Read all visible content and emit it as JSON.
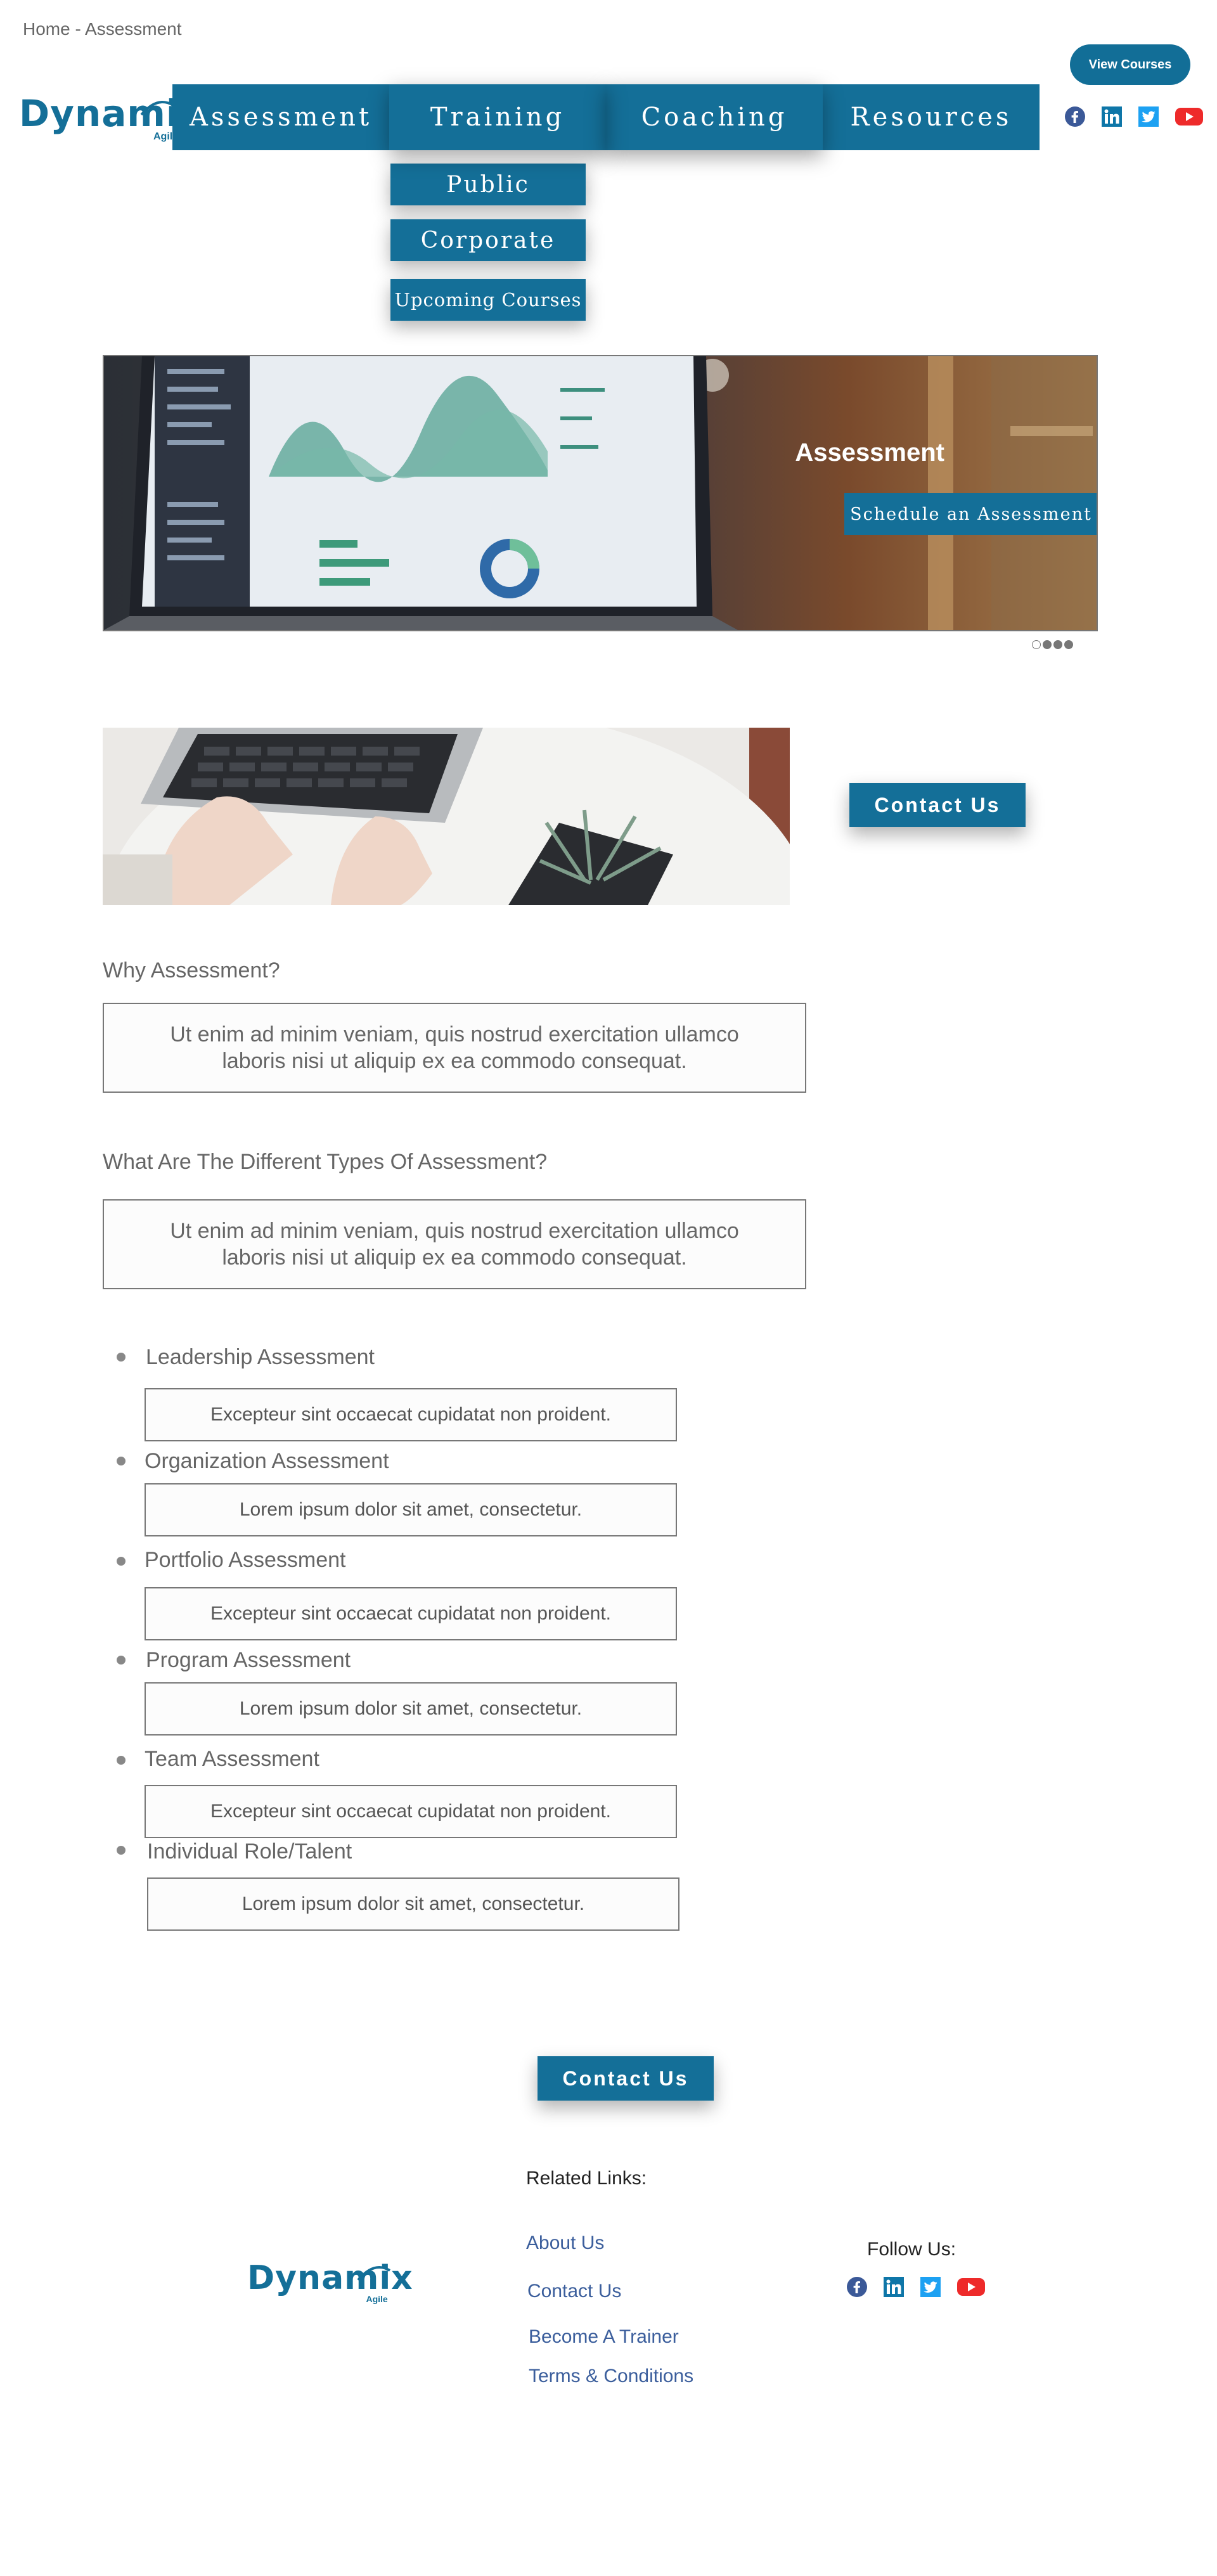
{
  "breadcrumb": "Home - Assessment",
  "header": {
    "view_courses": "View Courses",
    "logo_word": "Dynamix",
    "logo_sub": "Agile"
  },
  "nav": {
    "items": [
      "Assessment",
      "Training",
      "Coaching",
      "Resources"
    ],
    "training_submenu": [
      "Public",
      "Corporate",
      "Upcoming Courses"
    ]
  },
  "social_icons": [
    "facebook-icon",
    "linkedin-icon",
    "twitter-icon",
    "youtube-icon"
  ],
  "colors": {
    "brand": "#146f98",
    "facebook": "#3b5998",
    "linkedin": "#0e76a8",
    "twitter": "#1da1f2",
    "youtube": "#ee2a2a"
  },
  "banner": {
    "title": "Assessment",
    "button": "Schedule an Assessment",
    "slides": 4,
    "active_slide": 1
  },
  "contact_us_label": "Contact Us",
  "sections": [
    {
      "heading": "Why Assessment?",
      "text": "Ut enim ad minim veniam, quis nostrud exercitation ullamco laboris nisi ut aliquip ex ea commodo consequat."
    },
    {
      "heading": "What Are The Different Types Of Assessment?",
      "text": "Ut enim ad minim veniam, quis nostrud exercitation ullamco laboris nisi ut aliquip ex ea commodo consequat."
    }
  ],
  "assessments": [
    {
      "label": "Leadership Assessment",
      "desc": "Excepteur sint occaecat cupidatat non proident."
    },
    {
      "label": "Organization Assessment",
      "desc": "Lorem ipsum dolor sit amet, consectetur."
    },
    {
      "label": "Portfolio Assessment",
      "desc": "Excepteur sint occaecat cupidatat non proident."
    },
    {
      "label": "Program Assessment",
      "desc": "Lorem ipsum dolor sit amet, consectetur."
    },
    {
      "label": "Team Assessment",
      "desc": "Excepteur sint occaecat cupidatat non proident."
    },
    {
      "label": "Individual Role/Talent",
      "desc": "Lorem ipsum dolor sit amet, consectetur."
    }
  ],
  "footer": {
    "related_title": "Related Links:",
    "links": [
      "About Us",
      "Contact Us",
      "Become A Trainer",
      "Terms & Conditions"
    ],
    "follow_title": "Follow Us:"
  }
}
